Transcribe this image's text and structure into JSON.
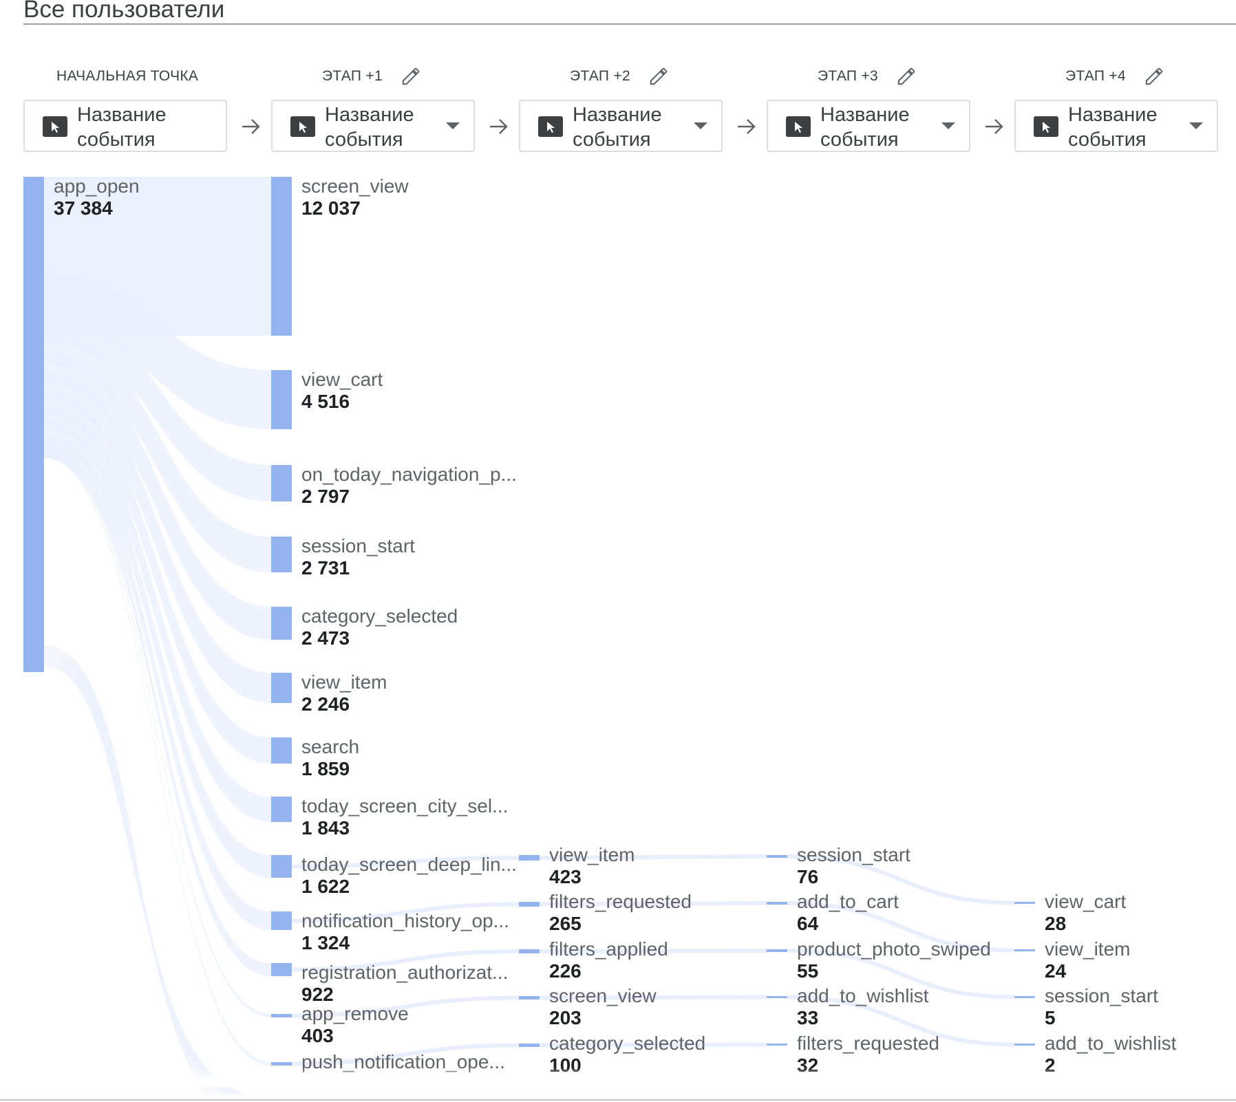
{
  "segment_title": "Все пользователи",
  "stages": [
    {
      "label": "НАЧАЛЬНАЯ ТОЧКА",
      "editable": false,
      "dropdown": "Название события",
      "has_caret": false
    },
    {
      "label": "ЭТАП +1",
      "editable": true,
      "dropdown": "Название события",
      "has_caret": true
    },
    {
      "label": "ЭТАП +2",
      "editable": true,
      "dropdown": "Название события",
      "has_caret": true
    },
    {
      "label": "ЭТАП +3",
      "editable": true,
      "dropdown": "Название события",
      "has_caret": true
    },
    {
      "label": "ЭТАП +4",
      "editable": true,
      "dropdown": "Название события",
      "has_caret": true
    }
  ],
  "colors": {
    "node": "#94b4f0",
    "flow": "#e8eefc",
    "accent_text": "#202124"
  },
  "chart_data": {
    "type": "sankey",
    "columns": [
      {
        "stage": "НАЧАЛЬНАЯ ТОЧКА",
        "nodes": [
          {
            "name": "app_open",
            "value": "37 384"
          }
        ]
      },
      {
        "stage": "ЭТАП +1",
        "nodes": [
          {
            "name": "screen_view",
            "value": "12 037"
          },
          {
            "name": "view_cart",
            "value": "4 516"
          },
          {
            "name": "on_today_navigation_p...",
            "value": "2 797"
          },
          {
            "name": "session_start",
            "value": "2 731"
          },
          {
            "name": "category_selected",
            "value": "2 473"
          },
          {
            "name": "view_item",
            "value": "2 246"
          },
          {
            "name": "search",
            "value": "1 859"
          },
          {
            "name": "today_screen_city_sel...",
            "value": "1 843"
          },
          {
            "name": "today_screen_deep_lin...",
            "value": "1 622"
          },
          {
            "name": "notification_history_op...",
            "value": "1 324"
          },
          {
            "name": "registration_authorizat...",
            "value": "922"
          },
          {
            "name": "app_remove",
            "value": "403"
          },
          {
            "name": "push_notification_ope...",
            "value": ""
          }
        ]
      },
      {
        "stage": "ЭТАП +2",
        "nodes": [
          {
            "name": "view_item",
            "value": "423"
          },
          {
            "name": "filters_requested",
            "value": "265"
          },
          {
            "name": "filters_applied",
            "value": "226"
          },
          {
            "name": "screen_view",
            "value": "203"
          },
          {
            "name": "category_selected",
            "value": "100"
          }
        ]
      },
      {
        "stage": "ЭТАП +3",
        "nodes": [
          {
            "name": "session_start",
            "value": "76"
          },
          {
            "name": "add_to_cart",
            "value": "64"
          },
          {
            "name": "product_photo_swiped",
            "value": "55"
          },
          {
            "name": "add_to_wishlist",
            "value": "33"
          },
          {
            "name": "filters_requested",
            "value": "32"
          }
        ]
      },
      {
        "stage": "ЭТАП +4",
        "nodes": [
          {
            "name": "view_cart",
            "value": "28"
          },
          {
            "name": "view_item",
            "value": "24"
          },
          {
            "name": "session_start",
            "value": "5"
          },
          {
            "name": "add_to_wishlist",
            "value": "2"
          }
        ]
      }
    ]
  }
}
